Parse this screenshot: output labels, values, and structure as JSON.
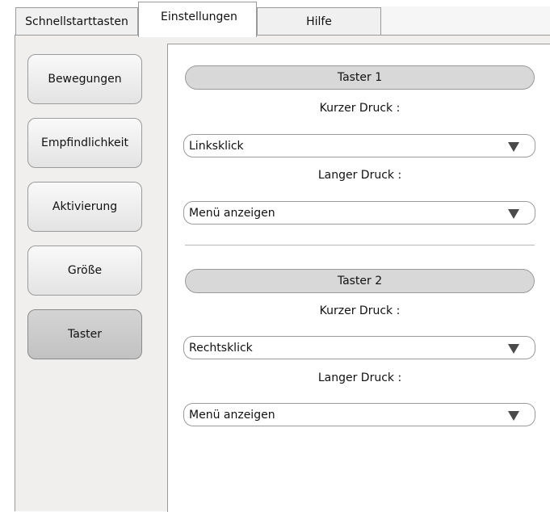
{
  "tabs": {
    "quickstart": "Schnellstarttasten",
    "settings": "Einstellungen",
    "help": "Hilfe"
  },
  "nav": {
    "items": [
      {
        "label": "Bewegungen",
        "active": false
      },
      {
        "label": "Empfindlichkeit",
        "active": false
      },
      {
        "label": "Aktivierung",
        "active": false
      },
      {
        "label": "Größe",
        "active": false
      },
      {
        "label": "Taster",
        "active": true
      }
    ]
  },
  "buttons": [
    {
      "header": "Taster 1",
      "short_label": "Kurzer Druck :",
      "short_value": "Linksklick",
      "long_label": "Langer Druck :",
      "long_value": "Menü anzeigen"
    },
    {
      "header": "Taster 2",
      "short_label": "Kurzer Druck :",
      "short_value": "Rechtsklick",
      "long_label": "Langer Druck :",
      "long_value": "Menü anzeigen"
    }
  ],
  "icons": {
    "dropdown": "triangle-down"
  }
}
